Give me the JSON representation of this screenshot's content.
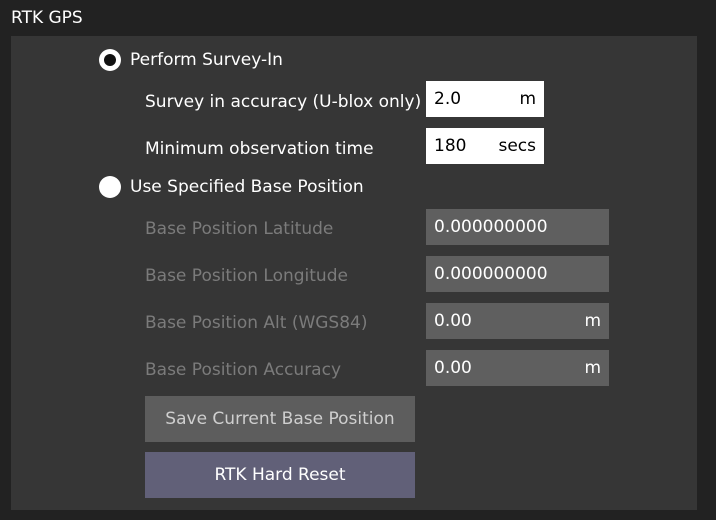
{
  "title": "RTK GPS",
  "survey_in": {
    "label": "Perform Survey-In",
    "selected": true,
    "accuracy": {
      "label": "Survey in accuracy (U-blox only)",
      "value": "2.0",
      "unit": "m"
    },
    "min_time": {
      "label": "Minimum observation time",
      "value": "180",
      "unit": "secs"
    }
  },
  "specified_base": {
    "label": "Use Specified Base Position",
    "selected": false,
    "latitude": {
      "label": "Base Position Latitude",
      "value": "0.000000000",
      "unit": ""
    },
    "longitude": {
      "label": "Base Position Longitude",
      "value": "0.000000000",
      "unit": ""
    },
    "altitude": {
      "label": "Base Position Alt (WGS84)",
      "value": "0.00",
      "unit": "m"
    },
    "accuracy": {
      "label": "Base Position Accuracy",
      "value": "0.00",
      "unit": "m"
    }
  },
  "buttons": {
    "save_label": "Save Current Base Position",
    "reset_label": "RTK Hard Reset"
  },
  "colors": {
    "background": "#222222",
    "panel": "#363636",
    "disabled_text": "#7b7b7b",
    "disabled_field": "#5f5f5f",
    "reset_button": "#616078"
  }
}
